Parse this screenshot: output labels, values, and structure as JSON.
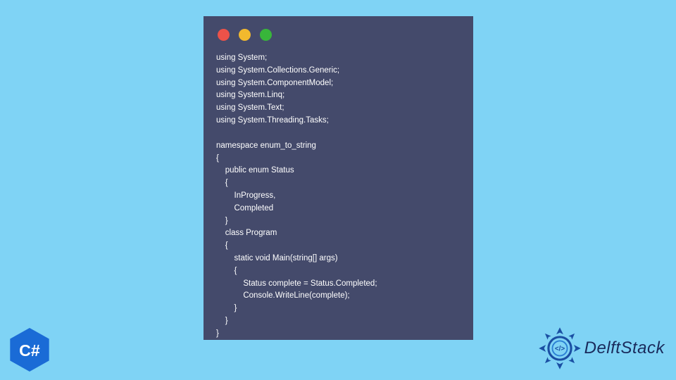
{
  "window": {
    "dots": {
      "red": "#ec5249",
      "yellow": "#f1b92e",
      "green": "#38b63a"
    }
  },
  "code": "using System;\nusing System.Collections.Generic;\nusing System.ComponentModel;\nusing System.Linq;\nusing System.Text;\nusing System.Threading.Tasks;\n\nnamespace enum_to_string\n{\n    public enum Status\n    {\n        InProgress,\n        Completed\n    }\n    class Program\n    {\n        static void Main(string[] args)\n        {\n            Status complete = Status.Completed;\n            Console.WriteLine(complete);\n        }\n    }\n}",
  "badges": {
    "csharp_label": "C#",
    "delft_label": "DelftStack"
  },
  "colors": {
    "page_bg": "#7fd3f5",
    "code_bg": "#444a6b",
    "code_fg": "#ffffff",
    "csharp_hex": "#1a6bd6",
    "delft_emblem": "#1a4fa3",
    "delft_text": "#1a2b5c"
  }
}
